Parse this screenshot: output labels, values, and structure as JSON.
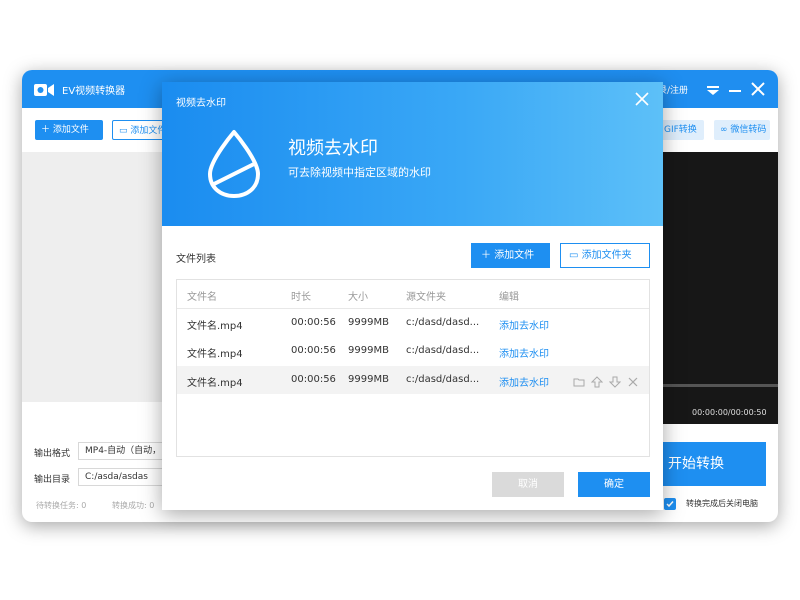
{
  "app": {
    "title": "EV视频转换器",
    "login": "录/注册",
    "toolbar": {
      "add_file": "添加文件",
      "add_folder": "添加文件",
      "gif": "GIF转换",
      "wechat": "微信转码"
    },
    "preview_time": "00:00:00/00:00:50",
    "output_format_label": "输出格式",
    "output_format_value": "MP4-自动（自动，自",
    "output_dir_label": "输出目录",
    "output_dir_value": "C:/asda/asdas",
    "pending": "待转换任务: 0",
    "done": "转换成功: 0",
    "start": "开始转换",
    "shutdown": "转换完成后关闭电脑",
    "accent": "#1e8ff1"
  },
  "dialog": {
    "title": "视频去水印",
    "heading": "视频去水印",
    "subtitle": "可去除视频中指定区域的水印",
    "list_title": "文件列表",
    "add_file": "添加文件",
    "add_folder": "添加文件夹",
    "columns": {
      "name": "文件名",
      "duration": "时长",
      "size": "大小",
      "source": "源文件夹",
      "edit": "编辑"
    },
    "rows": [
      {
        "name": "文件名.mp4",
        "duration": "00:00:56",
        "size": "9999MB",
        "source": "c:/dasd/dasd...",
        "action": "添加去水印"
      },
      {
        "name": "文件名.mp4",
        "duration": "00:00:56",
        "size": "9999MB",
        "source": "c:/dasd/dasd...",
        "action": "添加去水印"
      },
      {
        "name": "文件名.mp4",
        "duration": "00:00:56",
        "size": "9999MB",
        "source": "c:/dasd/dasd...",
        "action": "添加去水印"
      }
    ],
    "cancel": "取消",
    "ok": "确定"
  }
}
